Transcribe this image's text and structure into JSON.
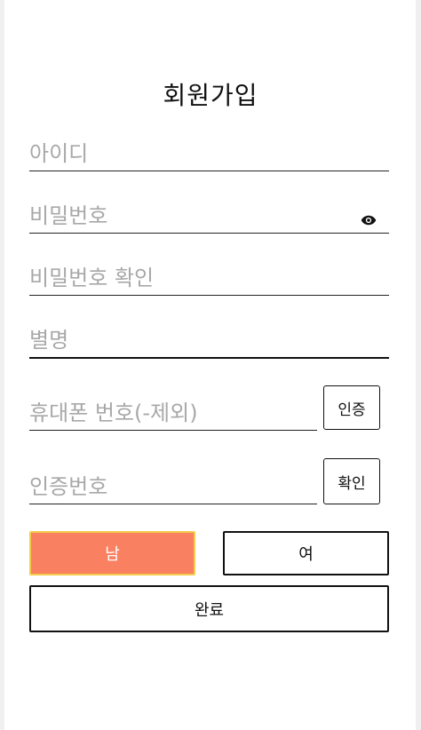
{
  "title": "회원가입",
  "fields": {
    "id_placeholder": "아이디",
    "password_placeholder": "비밀번호",
    "password_confirm_placeholder": "비밀번호 확인",
    "nickname_placeholder": "별명",
    "phone_placeholder": "휴대폰 번호(-제외)",
    "verify_code_placeholder": "인증번호"
  },
  "buttons": {
    "verify_request": "인증",
    "verify_confirm": "확인",
    "male": "남",
    "female": "여",
    "done": "완료"
  },
  "icons": {
    "password_toggle": "eye-icon"
  },
  "colors": {
    "male_selected_bg": "#fa8062",
    "male_selected_border": "#f5cc4a"
  }
}
